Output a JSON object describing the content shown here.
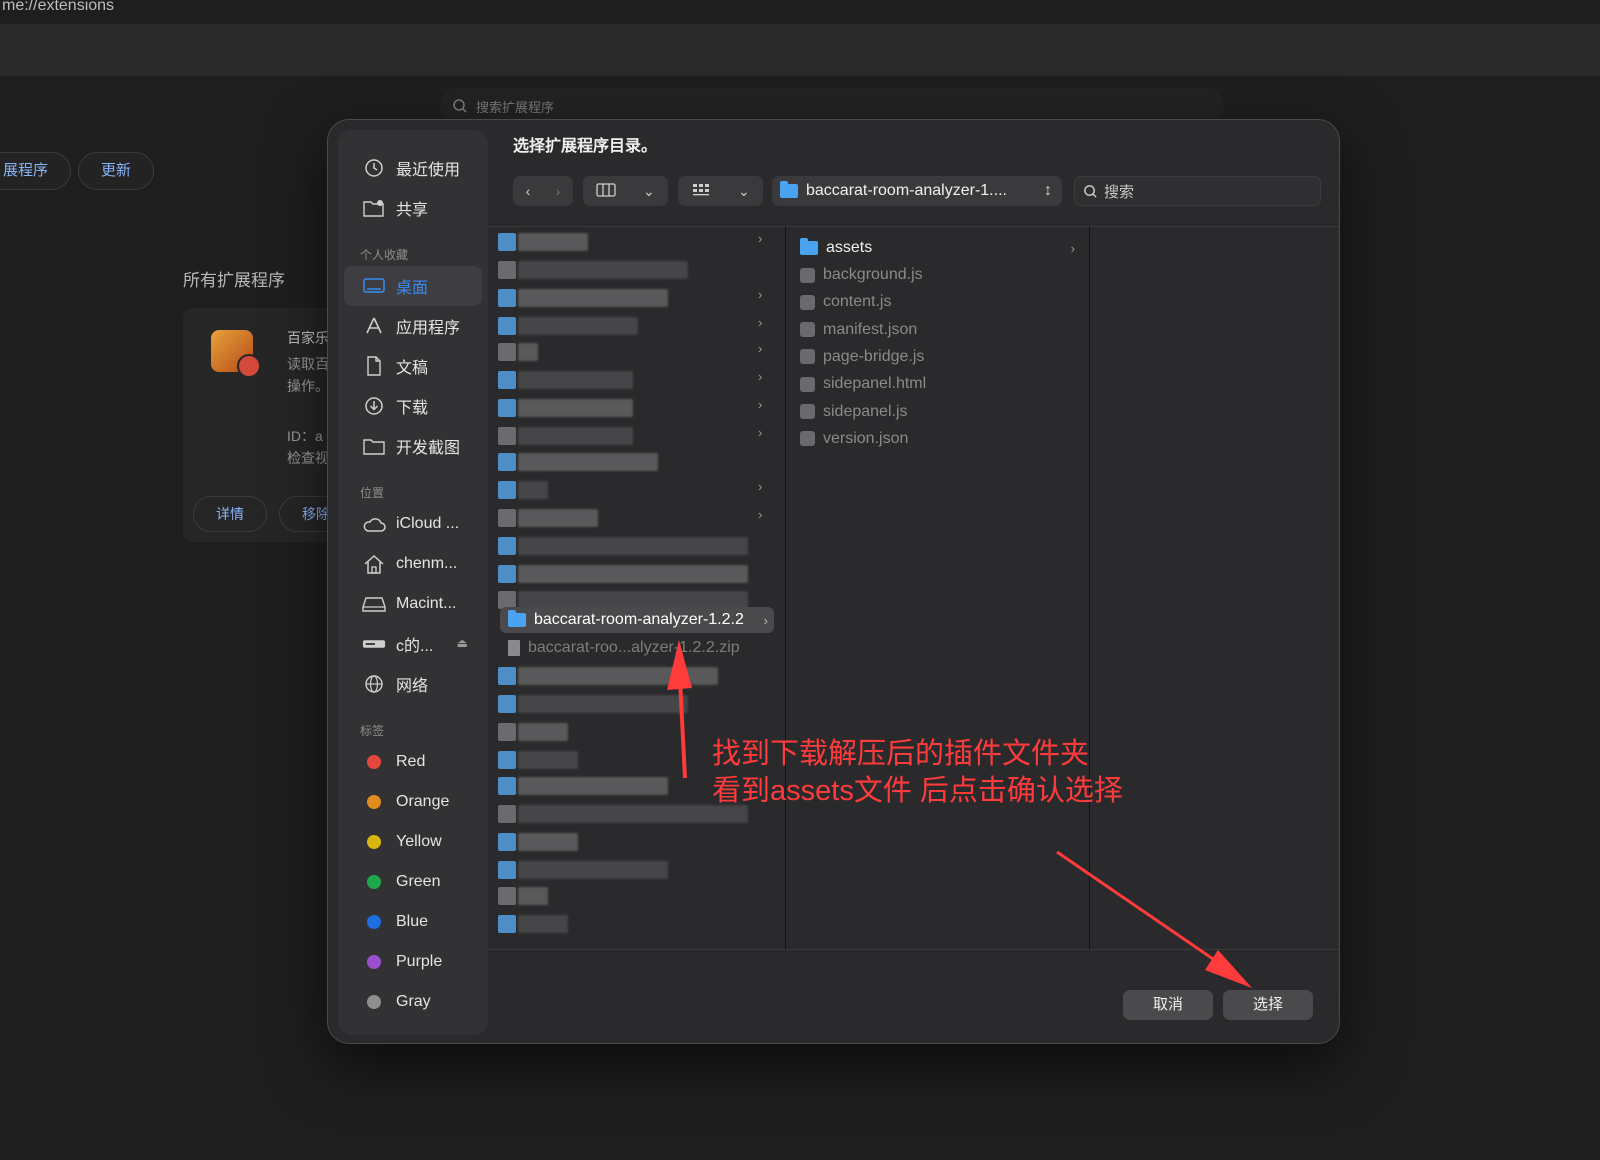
{
  "background": {
    "url": "me://extensions",
    "search_placeholder": "搜索扩展程序",
    "pill_left": "展程序",
    "pill_update": "更新",
    "heading": "所有扩展程序",
    "card": {
      "name": "百家乐",
      "desc_line1": "读取百",
      "desc_line2": "操作。",
      "id_line": "ID：a",
      "inspect_line": "检查视",
      "details_btn": "详情",
      "remove_btn": "移除"
    }
  },
  "dialog": {
    "title": "选择扩展程序目录。",
    "path_label": "baccarat-room-analyzer-1....",
    "search_placeholder": "搜索",
    "cancel_label": "取消",
    "select_label": "选择"
  },
  "sidebar": {
    "top": [
      {
        "label": "最近使用",
        "icon": "clock-icon"
      },
      {
        "label": "共享",
        "icon": "shared-folder-icon"
      }
    ],
    "favorites_title": "个人收藏",
    "favorites": [
      {
        "label": "桌面",
        "icon": "desktop-icon",
        "active": true
      },
      {
        "label": "应用程序",
        "icon": "applications-icon"
      },
      {
        "label": "文稿",
        "icon": "document-icon"
      },
      {
        "label": "下载",
        "icon": "download-icon"
      },
      {
        "label": "开发截图",
        "icon": "folder-icon"
      }
    ],
    "locations_title": "位置",
    "locations": [
      {
        "label": "iCloud ...",
        "icon": "cloud-icon"
      },
      {
        "label": "chenm...",
        "icon": "home-icon"
      },
      {
        "label": "Macint...",
        "icon": "disk-icon"
      },
      {
        "label": "c的...",
        "icon": "external-drive-icon"
      },
      {
        "label": "网络",
        "icon": "globe-icon"
      }
    ],
    "tags_title": "标签",
    "tags": [
      {
        "label": "Red",
        "color": "#e5473e"
      },
      {
        "label": "Orange",
        "color": "#e08d1e"
      },
      {
        "label": "Yellow",
        "color": "#d6b60f"
      },
      {
        "label": "Green",
        "color": "#1fa84b"
      },
      {
        "label": "Blue",
        "color": "#1d6ee0"
      },
      {
        "label": "Purple",
        "color": "#9b4fd0"
      },
      {
        "label": "Gray",
        "color": "#8e8e8e"
      }
    ]
  },
  "left_column": {
    "selected_folder": "baccarat-room-analyzer-1.2.2",
    "zip_file": "baccarat-roo...alyzer-1.2.2.zip"
  },
  "middle_column": {
    "folder": "assets",
    "files": [
      "background.js",
      "content.js",
      "manifest.json",
      "page-bridge.js",
      "sidepanel.html",
      "sidepanel.js",
      "version.json"
    ]
  },
  "annotation": {
    "line1": "找到下载解压后的插件文件夹",
    "line2": "看到assets文件 后点击确认选择",
    "color": "#ff3b3b"
  }
}
